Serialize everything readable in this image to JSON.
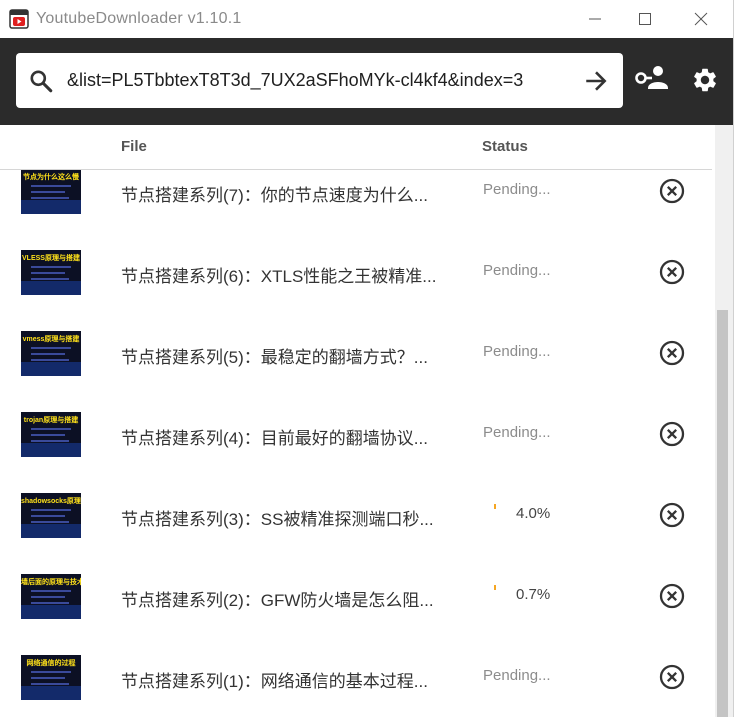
{
  "window": {
    "title": "YoutubeDownloader v1.10.1",
    "icon": "youtube-downloader-app-icon",
    "controls": [
      "minimize-icon",
      "maximize-icon",
      "close-icon"
    ]
  },
  "toolbar": {
    "url_value": "&list=PL5TbbtexT8T3d_7UX2aSFhoMYk-cl4kf4&index=3",
    "icons": [
      "search-icon",
      "arrow-right-icon",
      "user-key-icon",
      "gear-icon"
    ]
  },
  "table": {
    "columns": {
      "file": "File",
      "status": "Status"
    },
    "rows": [
      {
        "thumb_caption": "节点为什么这么慢",
        "title": "节点搭建系列(7)：你的节点速度为什么...",
        "status": "Pending...",
        "progress": null
      },
      {
        "thumb_caption": "VLESS原理与搭建",
        "title": "节点搭建系列(6)：XTLS性能之王被精准...",
        "status": "Pending...",
        "progress": null
      },
      {
        "thumb_caption": "vmess原理与搭建",
        "title": "节点搭建系列(5)：最稳定的翻墙方式？...",
        "status": "Pending...",
        "progress": null
      },
      {
        "thumb_caption": "trojan原理与搭建",
        "title": "节点搭建系列(4)：目前最好的翻墙协议...",
        "status": "Pending...",
        "progress": null
      },
      {
        "thumb_caption": "shadowsocks原理与搭建",
        "title": "节点搭建系列(3)：SS被精准探测端口秒...",
        "status": "4.0%",
        "progress": 0.04
      },
      {
        "thumb_caption": "墙后面的原理与技术",
        "title": "节点搭建系列(2)：GFW防火墙是怎么阻...",
        "status": "0.7%",
        "progress": 0.007
      },
      {
        "thumb_caption": "网络通信的过程",
        "title": "节点搭建系列(1)：网络通信的基本过程...",
        "status": "Pending...",
        "progress": null
      }
    ]
  },
  "colors": {
    "toolbar_bg": "#2b2b2b",
    "accent": "#f5a623",
    "thumb_text": "#ffe11a"
  }
}
